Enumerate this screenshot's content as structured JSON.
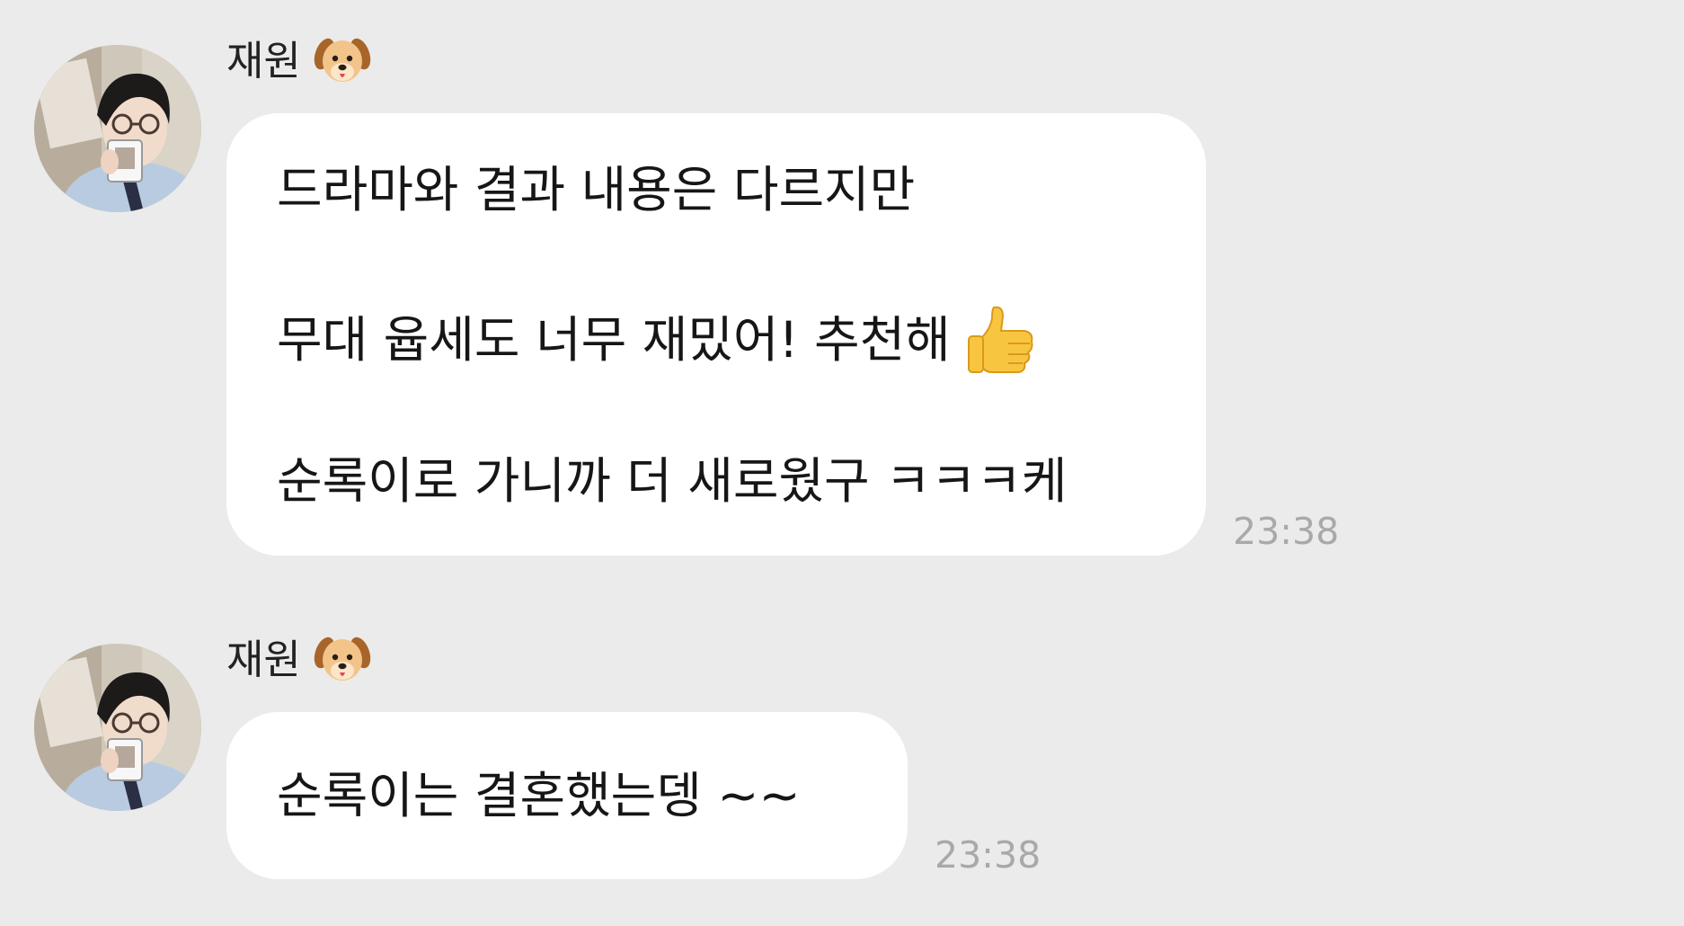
{
  "messages": [
    {
      "sender": "재원",
      "sender_emoji_icon": "dog-face-icon",
      "lines": [
        "드라마와 결과 내용은 다르지만",
        "무대 윱세도 너무 재밌어! 추천해",
        "순록이로 가니까 더 새로웠구 ㅋㅋㅋ케"
      ],
      "line_emoji": {
        "line_index": 1,
        "icon": "thumbs-up-icon"
      },
      "time": "23:38"
    },
    {
      "sender": "재원",
      "sender_emoji_icon": "dog-face-icon",
      "lines": [
        "순록이는 결혼했는뎅 ~~"
      ],
      "time": "23:38"
    }
  ],
  "colors": {
    "background": "#ebebeb",
    "bubble": "#ffffff",
    "timestamp": "#a9a9a9"
  }
}
